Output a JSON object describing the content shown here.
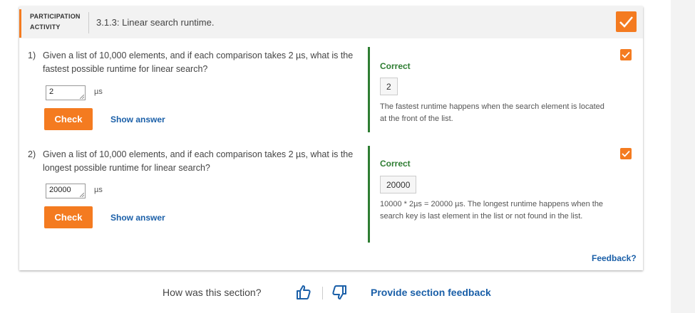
{
  "header": {
    "participation_label": "PARTICIPATION ACTIVITY",
    "activity_title": "3.1.3: Linear search runtime.",
    "completed_icon": "checkmark-icon"
  },
  "questions": [
    {
      "number": "1)",
      "text": "Given a list of 10,000 elements, and if each comparison takes 2 µs, what is the fastest possible runtime for linear search?",
      "input_value": "2",
      "unit": "µs",
      "check_label": "Check",
      "show_answer_label": "Show answer",
      "feedback": {
        "status": "Correct",
        "answer": "2",
        "explanation": "The fastest runtime happens when the search element is located at the front of the list."
      },
      "status_icon": "checkmark-icon"
    },
    {
      "number": "2)",
      "text": "Given a list of 10,000 elements, and if each comparison takes 2 µs, what is the longest possible runtime for linear search?",
      "input_value": "20000",
      "unit": "µs",
      "check_label": "Check",
      "show_answer_label": "Show answer",
      "feedback": {
        "status": "Correct",
        "answer": "20000",
        "explanation": "10000 * 2µs = 20000 µs. The longest runtime happens when the search key is last element in the list or not found in the list."
      },
      "status_icon": "checkmark-icon"
    }
  ],
  "feedback_link": "Feedback?",
  "section_feedback": {
    "question": "How was this section?",
    "thumbs_up_icon": "thumbs-up-icon",
    "thumbs_down_icon": "thumbs-down-icon",
    "provide_label": "Provide section feedback"
  },
  "colors": {
    "accent": "#f47b20",
    "correct": "#2e7d32",
    "link": "#1a5fa8"
  }
}
